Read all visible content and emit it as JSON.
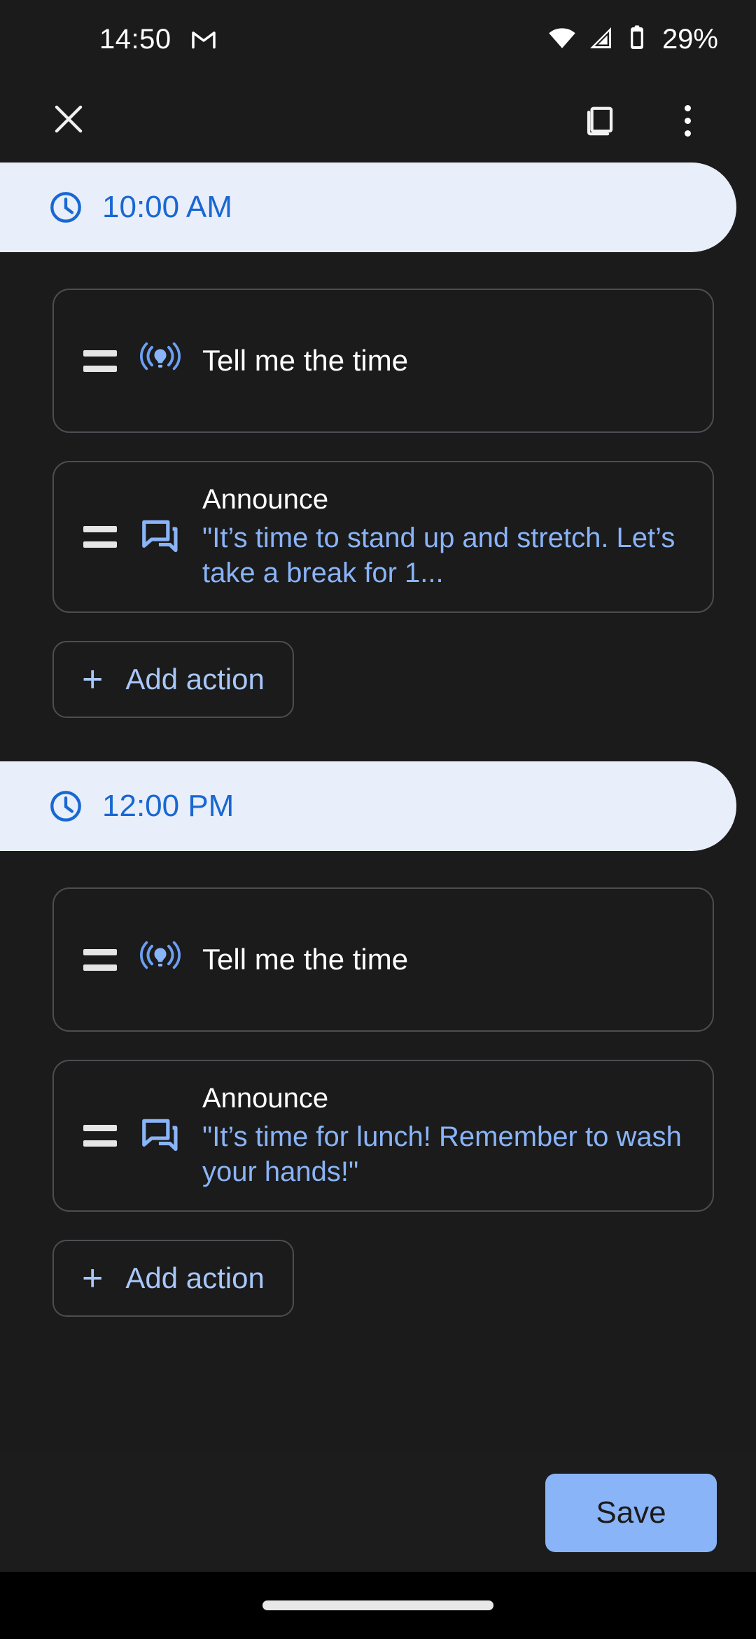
{
  "status_bar": {
    "clock": "14:50",
    "notification_icon": "gmail-icon",
    "wifi_icon": "wifi-icon",
    "signal_icon": "cellular-signal-icon",
    "battery_icon": "battery-icon",
    "battery_text": "29%"
  },
  "toolbar": {
    "close_icon": "close-icon",
    "duplicate_icon": "duplicate-icon",
    "overflow_icon": "more-vert-icon"
  },
  "colors": {
    "background": "#1b1b1b",
    "chip_background": "#e8eefa",
    "chip_text": "#1967d2",
    "accent_blue": "#8ab4f8",
    "link_blue": "#a8c7fa",
    "card_border": "#4b4e51",
    "save_background": "#8ab4f8",
    "save_text": "#1b1b1b"
  },
  "groups": [
    {
      "time": "10:00 AM",
      "time_icon": "clock-icon",
      "actions": [
        {
          "handle_icon": "drag-handle-icon",
          "icon": "broadcast-icon",
          "title": "Tell me the time",
          "subtitle": ""
        },
        {
          "handle_icon": "drag-handle-icon",
          "icon": "forum-icon",
          "title": "Announce",
          "subtitle": "\"It’s time to stand up and stretch. Let’s take a break for 1..."
        }
      ],
      "add_action": {
        "icon": "plus-icon",
        "label": "Add action"
      }
    },
    {
      "time": "12:00 PM",
      "time_icon": "clock-icon",
      "actions": [
        {
          "handle_icon": "drag-handle-icon",
          "icon": "broadcast-icon",
          "title": "Tell me the time",
          "subtitle": ""
        },
        {
          "handle_icon": "drag-handle-icon",
          "icon": "forum-icon",
          "title": "Announce",
          "subtitle": "\"It’s time for lunch! Remember to wash your hands!\""
        }
      ],
      "add_action": {
        "icon": "plus-icon",
        "label": "Add action"
      }
    }
  ],
  "bottom_bar": {
    "save_label": "Save"
  },
  "nav_bar": {
    "home_pill": "home-gesture-pill"
  }
}
